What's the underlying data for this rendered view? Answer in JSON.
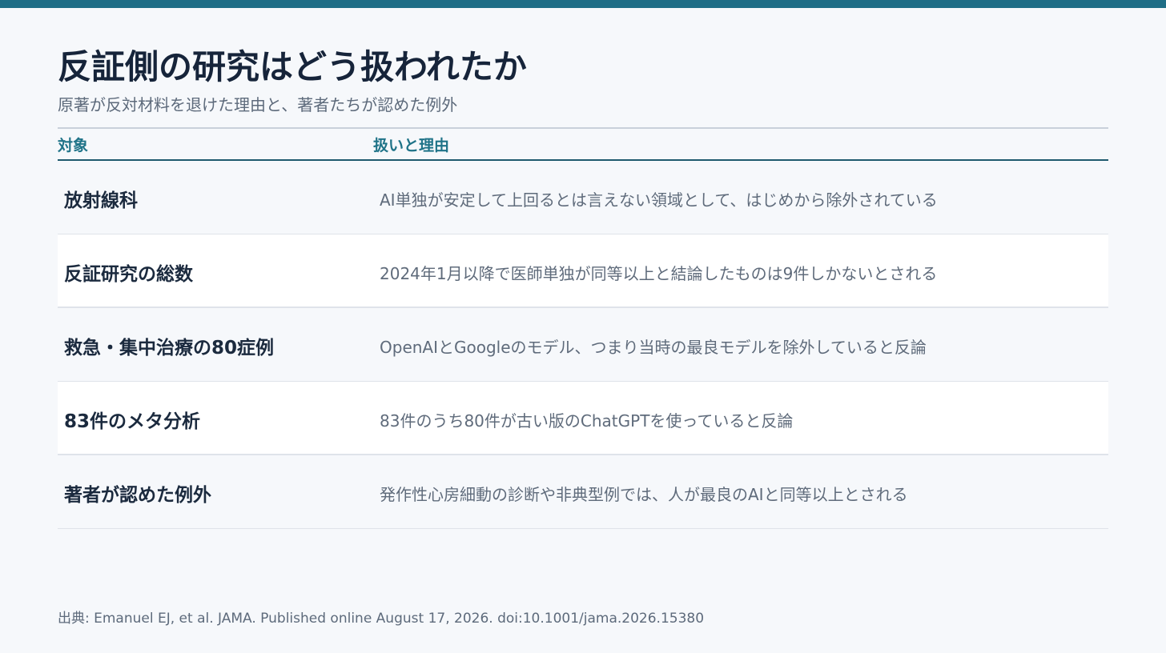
{
  "header": {
    "title": "反証側の研究はどう扱われたか",
    "subtitle": "原著が反対材料を退けた理由と、著者たちが認めた例外"
  },
  "table": {
    "columns": [
      "対象",
      "扱いと理由"
    ],
    "rows": [
      {
        "target": "放射線科",
        "reason": "AI単独が安定して上回るとは言えない領域として、はじめから除外されている"
      },
      {
        "target": "反証研究の総数",
        "reason": "2024年1月以降で医師単独が同等以上と結論したものは9件しかないとされる"
      },
      {
        "target": "救急・集中治療の80症例",
        "reason": "OpenAIとGoogleのモデル、つまり当時の最良モデルを除外していると反論"
      },
      {
        "target": "83件のメタ分析",
        "reason": "83件のうち80件が古い版のChatGPTを使っていると反論"
      },
      {
        "target": "著者が認めた例外",
        "reason": "発作性心房細動の診断や非典型例では、人が最良のAIと同等以上とされる"
      }
    ]
  },
  "footer": {
    "source": "出典: Emanuel EJ, et al. JAMA. Published online August 17, 2026. doi:10.1001/jama.2026.15380"
  },
  "colors": {
    "accent": "#1f6e86",
    "header_text": "#1f7388",
    "background": "#f6f8fb"
  }
}
